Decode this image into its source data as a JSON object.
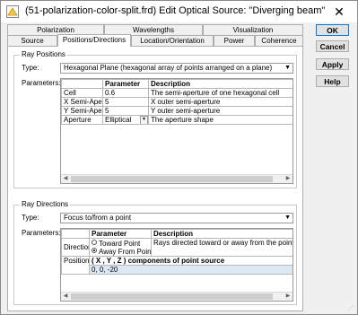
{
  "window": {
    "title": "(51-polarization-color-split.frd) Edit Optical Source: \"Diverging beam\""
  },
  "tabs": {
    "back": [
      "Polarization",
      "Wavelengths",
      "Visualization"
    ],
    "front": [
      "Source",
      "Positions/Directions",
      "Location/Orientation",
      "Power",
      "Coherence"
    ]
  },
  "ray_positions": {
    "legend": "Ray Positions",
    "type_label": "Type:",
    "type_value": "Hexagonal Plane (hexagonal array of points arranged on a plane)",
    "params_label": "Parameters:",
    "headers": [
      "Parameter",
      "Description"
    ],
    "rows": [
      {
        "name": "Cell",
        "value": "0.6",
        "desc": "The semi-aperture of one hexagonal cell"
      },
      {
        "name": "X Semi-Ape",
        "value": "5",
        "desc": "X outer semi-aperture"
      },
      {
        "name": "Y Semi-Ape",
        "value": "5",
        "desc": "Y outer semi-aperture"
      },
      {
        "name": "Aperture",
        "value": "Elliptical",
        "desc": "The aperture shape"
      }
    ]
  },
  "ray_directions": {
    "legend": "Ray Directions",
    "type_label": "Type:",
    "type_value": "Focus to/from a point",
    "params_label": "Parameters:",
    "headers": [
      "Parameter",
      "Description"
    ],
    "direction": {
      "label": "Direction",
      "options": [
        "Toward Point",
        "Away From Point"
      ],
      "selected": "Away From Point",
      "desc": "Rays directed toward or away from the point source"
    },
    "position": {
      "label": "Position",
      "heading": "( X , Y , Z ) components of point source",
      "value": "0,  0,  -20"
    }
  },
  "buttons": {
    "ok": "OK",
    "cancel": "Cancel",
    "apply": "Apply",
    "help": "Help"
  },
  "colors": {
    "accent": "#0078d7",
    "selection": "#dde8f5"
  }
}
